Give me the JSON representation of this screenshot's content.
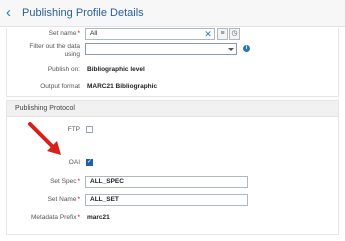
{
  "header": {
    "back_icon": "chevron-left-icon",
    "title": "Publishing Profile Details"
  },
  "top_section": {
    "set_name": {
      "label": "Set name",
      "value": "All"
    },
    "filter": {
      "label_line1": "Filter out the data",
      "label_line2": "using",
      "value": ""
    },
    "publish_on": {
      "label": "Publish on:",
      "value": "Bibliographic level"
    },
    "output_format": {
      "label": "Output format",
      "value": "MARC21 Bibliographic"
    }
  },
  "protocol_section": {
    "title": "Publishing Protocol",
    "ftp": {
      "label": "FTP",
      "checked": false
    },
    "oai": {
      "label": "OAI",
      "checked": true
    },
    "set_spec": {
      "label": "Set Spec",
      "value": "ALL_SPEC"
    },
    "set_name": {
      "label": "Set Name",
      "value": "ALL_SET"
    },
    "metadata_prefix": {
      "label": "Metadata Prefix",
      "value": "marc21"
    }
  },
  "required_mark": "*",
  "colors": {
    "accent": "#2a76b9",
    "arrow": "#d9201c",
    "required": "#cc0000"
  }
}
